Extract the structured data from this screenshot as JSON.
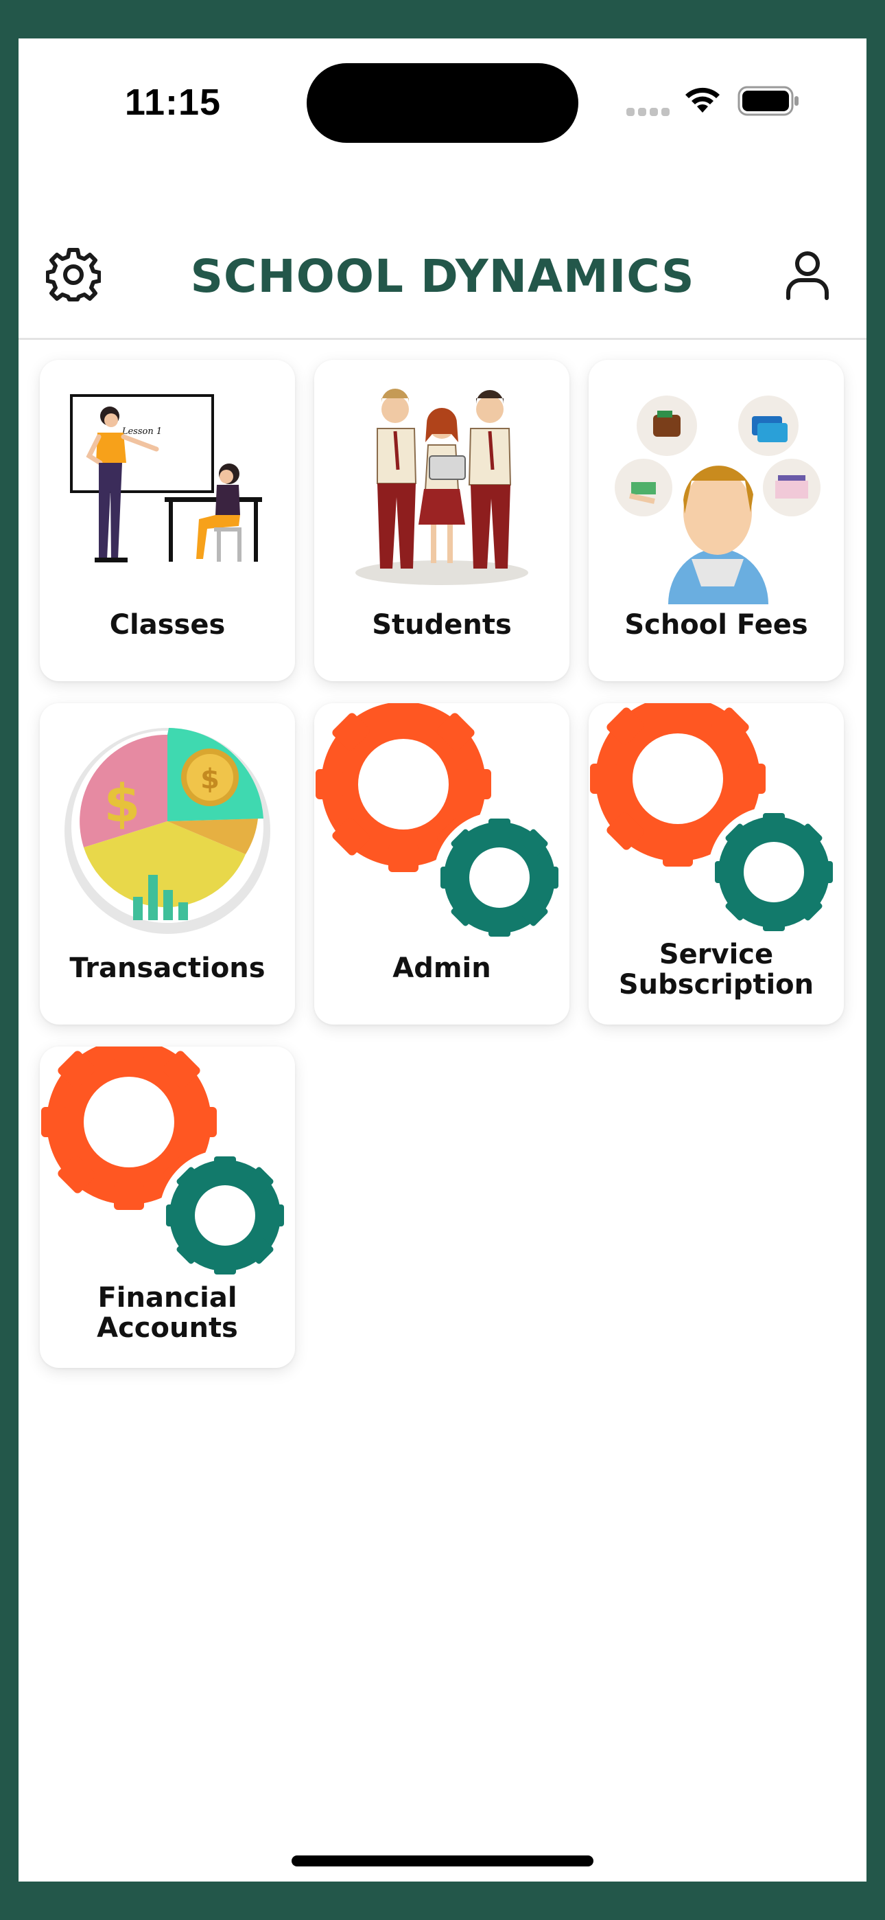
{
  "status_bar": {
    "time": "11:15"
  },
  "header": {
    "title": "SCHOOL DYNAMICS"
  },
  "tiles": [
    {
      "label": "Classes",
      "board_text": "Lesson 1"
    },
    {
      "label": "Students"
    },
    {
      "label": "School Fees"
    },
    {
      "label": "Transactions"
    },
    {
      "label": "Admin"
    },
    {
      "label_line1": "Service",
      "label_line2": "Subscription"
    },
    {
      "label_line1": "Financial",
      "label_line2": "Accounts"
    }
  ],
  "icons": {
    "settings": "gear-icon",
    "profile": "user-icon"
  },
  "colors": {
    "brand_green": "#23574a",
    "gear_orange": "#ff5722",
    "gear_teal": "#127a6b"
  }
}
